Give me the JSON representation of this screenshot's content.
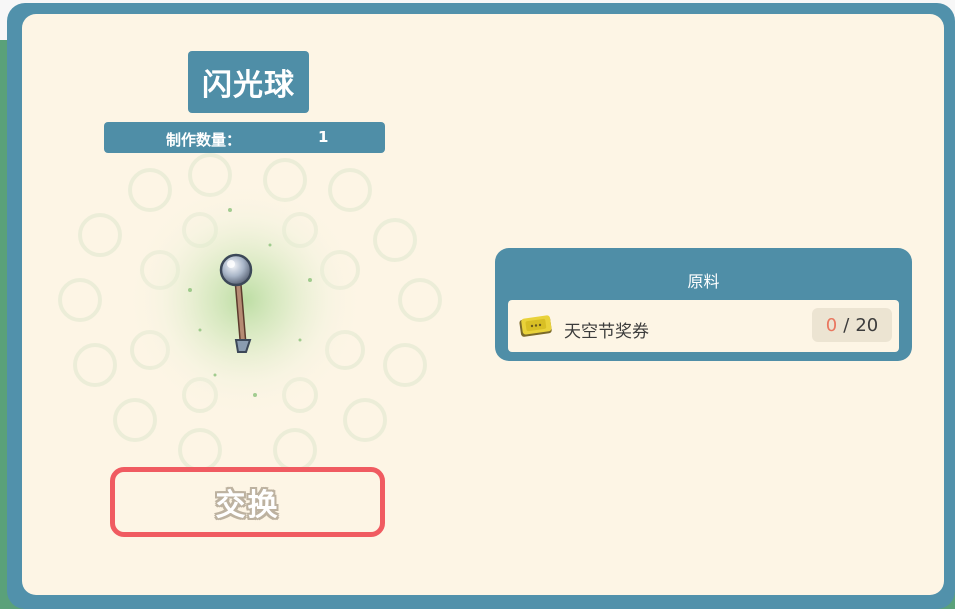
{
  "item": {
    "name": "闪光球",
    "icon": "flash-ball-wand-icon"
  },
  "craft": {
    "quantity_label": "制作数量：",
    "quantity_value": "1"
  },
  "materials": {
    "header": "原料",
    "items": [
      {
        "name": "天空节奖券",
        "icon": "ticket-icon",
        "have": "0",
        "separator": "/",
        "need": "20"
      }
    ]
  },
  "actions": {
    "exchange_label": "交换"
  },
  "colors": {
    "frame": "#5191ab",
    "panel": "#fdf5e5",
    "header_bar": "#4f8ea7",
    "button_border": "#f05b61",
    "count_have": "#e9775f"
  }
}
